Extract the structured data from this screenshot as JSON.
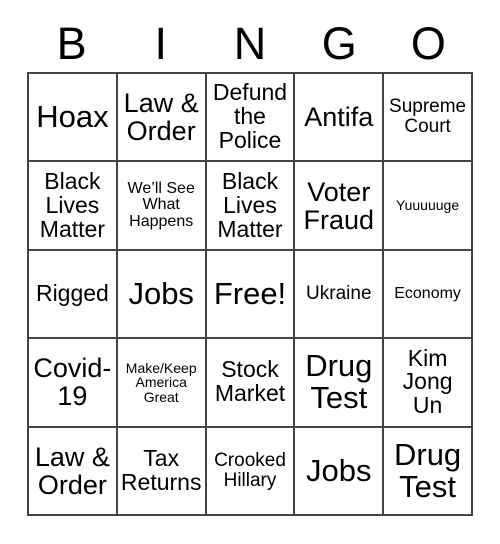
{
  "card": {
    "header_letters": [
      "B",
      "I",
      "N",
      "G",
      "O"
    ],
    "rows": [
      [
        {
          "text": "Hoax",
          "size": "xl"
        },
        {
          "text": "Law &\nOrder",
          "size": "lg"
        },
        {
          "text": "Defund\nthe\nPolice",
          "size": "md"
        },
        {
          "text": "Antifa",
          "size": "lg"
        },
        {
          "text": "Supreme\nCourt",
          "size": "sm"
        }
      ],
      [
        {
          "text": "Black\nLives\nMatter",
          "size": "md"
        },
        {
          "text": "We’ll See\nWhat\nHappens",
          "size": "xs"
        },
        {
          "text": "Black\nLives\nMatter",
          "size": "md"
        },
        {
          "text": "Voter\nFraud",
          "size": "lg"
        },
        {
          "text": "Yuuuuuge",
          "size": "xxs"
        }
      ],
      [
        {
          "text": "Rigged",
          "size": "md"
        },
        {
          "text": "Jobs",
          "size": "xl"
        },
        {
          "text": "Free!",
          "size": "xl"
        },
        {
          "text": "Ukraine",
          "size": "sm"
        },
        {
          "text": "Economy",
          "size": "xs"
        }
      ],
      [
        {
          "text": "Covid-\n19",
          "size": "lg"
        },
        {
          "text": "Make/Keep\nAmerica\nGreat",
          "size": "xxs"
        },
        {
          "text": "Stock\nMarket",
          "size": "md"
        },
        {
          "text": "Drug\nTest",
          "size": "xl"
        },
        {
          "text": "Kim\nJong\nUn",
          "size": "md"
        }
      ],
      [
        {
          "text": "Law &\nOrder",
          "size": "lg"
        },
        {
          "text": "Tax\nReturns",
          "size": "md"
        },
        {
          "text": "Crooked\nHillary",
          "size": "sm"
        },
        {
          "text": "Jobs",
          "size": "xl"
        },
        {
          "text": "Drug\nTest",
          "size": "xl"
        }
      ]
    ]
  }
}
